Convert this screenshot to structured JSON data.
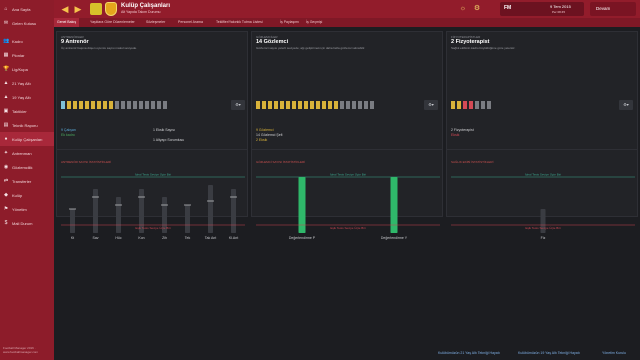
{
  "sidebar": {
    "items": [
      {
        "label": "Ana Sayfa",
        "icon": "home-icon",
        "glyph": "⌂"
      },
      {
        "label": "Gelen Kutusu",
        "icon": "inbox-icon",
        "glyph": "✉"
      },
      {
        "label": "Kadro",
        "icon": "squad-icon",
        "glyph": "👥"
      },
      {
        "label": "Plonlar",
        "icon": "tactics-icon",
        "glyph": "▦"
      },
      {
        "label": "Lig/Kupa",
        "icon": "trophy-icon",
        "glyph": "🏆"
      },
      {
        "label": "21 Yaş Altı",
        "icon": "u21-icon",
        "glyph": "▲"
      },
      {
        "label": "19 Yaş Altı",
        "icon": "u19-icon",
        "glyph": "▲"
      },
      {
        "label": "Taktikler",
        "icon": "board-icon",
        "glyph": "▣"
      },
      {
        "label": "Teknik Raporu",
        "icon": "report-icon",
        "glyph": "▤"
      },
      {
        "label": "Kulüp Çalışanları",
        "icon": "staff-icon",
        "glyph": "●"
      },
      {
        "label": "Antrenman",
        "icon": "training-icon",
        "glyph": "✦"
      },
      {
        "label": "Gözlemcilik",
        "icon": "scouting-icon",
        "glyph": "◉"
      },
      {
        "label": "Transferler",
        "icon": "transfers-icon",
        "glyph": "⇄"
      },
      {
        "label": "Kulüp",
        "icon": "club-icon",
        "glyph": "◆"
      },
      {
        "label": "Yönetim",
        "icon": "board-members-icon",
        "glyph": "⚑"
      },
      {
        "label": "Mali Durum",
        "icon": "finance-icon",
        "glyph": "$"
      }
    ],
    "footer": "Football Manager 2016 · www.footballmanager.com"
  },
  "header": {
    "title": "Kulüp Çalışanları",
    "subtitle": "Alt Yapıda Takım Durumu",
    "date_label": "9 Tem 2015",
    "date_sub": "Per 08:45",
    "badge": "FM",
    "continue_label": "Devam"
  },
  "tabs": [
    "Genel Bakış",
    "Yaşlılara Göre Düzenlemeler",
    "Sözleşmeler",
    "Personel Arama",
    "Teklifler/Yakınlık Tutma Listesi",
    "İş Paylaşımı",
    "İş Geçmişi"
  ],
  "panels": [
    {
      "label": "ANTRENÖRLER",
      "heading": "9 Antrenör",
      "desc": "Üç antrenör başına düşen oyuncu sayısı makul seviyede.",
      "figure_colors": [
        "#7fc1d6",
        "#d9b33a",
        "#d9b33a",
        "#d9b33a",
        "#d9b33a",
        "#d9b33a",
        "#d9b33a",
        "#d9b33a",
        "#d9b33a",
        "#7a7c82",
        "#7a7c82",
        "#7a7c82",
        "#7a7c82",
        "#7a7c82",
        "#7a7c82",
        "#7a7c82",
        "#7a7c82",
        "#7a7c82"
      ],
      "stats": [
        {
          "text": "9 Çalışan",
          "color": "#5aa9d6"
        },
        {
          "text": "Ek kadro",
          "color": "#4caa5e"
        },
        {
          "text": "1 Eksik Sayısı",
          "color": "#d0d1d4"
        },
        {
          "text": "1 Altyapı Sorumlusu",
          "color": "#d0d1d4"
        }
      ],
      "chart_label": "ANTRENÖR SAYISI İSTATİSTİKLERİ"
    },
    {
      "label": "GÖZLEMCİLER",
      "heading": "14 Gözlemci",
      "desc": "Gözlemci sayısı yeterli seviyede; ağı geliştirmek için daha fazla gözlemci alınabilir.",
      "figure_colors": [
        "#d9b33a",
        "#d9b33a",
        "#d9b33a",
        "#d9b33a",
        "#d9b33a",
        "#d9b33a",
        "#d9b33a",
        "#d9b33a",
        "#d9b33a",
        "#d9b33a",
        "#d9b33a",
        "#d9b33a",
        "#d9b33a",
        "#d9b33a",
        "#7a7c82",
        "#7a7c82",
        "#7a7c82",
        "#7a7c82",
        "#7a7c82",
        "#7a7c82"
      ],
      "stats": [
        {
          "text": "9 Gözlemci",
          "color": "#d9b33a"
        },
        {
          "text": "14 Gözlemci Şefi",
          "color": "#d0d1d4"
        },
        {
          "text": "2 Eksik",
          "color": "#d9b33a"
        }
      ],
      "chart_label": "GÖZLEMCİ SAYISI İSTATİSTİKLERİ"
    },
    {
      "label": "FİZYOTERAPİSTLER",
      "heading": "2 Fizyoterapist",
      "desc": "Sağlık ekibinin kadro büyüklüğüne göre yetersiz.",
      "figure_colors": [
        "#d9b33a",
        "#d9b33a",
        "#d44a55",
        "#d44a55",
        "#7a7c82",
        "#7a7c82",
        "#7a7c82"
      ],
      "stats": [
        {
          "text": "2 Fizyoterapist",
          "color": "#d0d1d4"
        },
        {
          "text": "Eksik",
          "color": "#d44a55"
        }
      ],
      "chart_label": "SAĞLIK EKİBİ İSTATİSTİKLERİ"
    }
  ],
  "chart_data": [
    {
      "type": "bar",
      "categories": [
        "Kt",
        "Sav",
        "Hüc",
        "Kon",
        "Zih",
        "Tek",
        "Tak Ant",
        "Kl.Ant"
      ],
      "values": [
        6,
        11,
        9,
        11,
        9,
        7,
        12,
        11
      ],
      "ylim": [
        0,
        16
      ],
      "markers": [
        6,
        9,
        7,
        9,
        7,
        7,
        8,
        9
      ],
      "ref_top": {
        "value": 14,
        "label": "İdeal Tesis Seviye Üçte Biri"
      },
      "ref_bottom": {
        "value": 2,
        "label": "Eşik Tesis Seviye Üçte Biri"
      },
      "bar_color": "#3a3c42"
    },
    {
      "type": "bar",
      "categories": [
        "Değerlendirme P",
        "Değerlendirme Y"
      ],
      "values": [
        14,
        14
      ],
      "ylim": [
        0,
        16
      ],
      "ref_top": {
        "value": 14,
        "label": "İdeal Tesis Seviye Üçte Biri"
      },
      "ref_bottom": {
        "value": 2,
        "label": "Eşik Tesis Seviye Üçte Biri"
      },
      "bar_color": "#2fb86a"
    },
    {
      "type": "bar",
      "categories": [
        "Fiz"
      ],
      "values": [
        6
      ],
      "ylim": [
        0,
        16
      ],
      "ref_top": {
        "value": 14,
        "label": "İdeal Tesis Seviye Üçte Biri"
      },
      "ref_bottom": {
        "value": 2,
        "label": "Eşik Tesis Seviye Üçte Biri"
      },
      "bar_color": "#3a3c42"
    }
  ],
  "footer": {
    "links": [
      "Kulübümüzün 21 Yaş Altı Tekniği Hayatı",
      "Kulübümüzün 19 Yaş Altı Tekniği Hayatı",
      "Yönetim Kurulu"
    ]
  },
  "colors": {
    "sidebar": "#8d1c2a",
    "accent": "#a8283a",
    "ideal_line": "#3aa58c",
    "threshold_line": "#c74450"
  }
}
